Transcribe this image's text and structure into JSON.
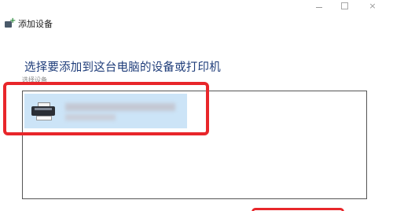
{
  "window": {
    "title": "添加设备",
    "controls": {
      "minimize": "minimize",
      "maximize": "maximize",
      "close": "×"
    }
  },
  "main": {
    "heading": "选择要添加到这台电脑的设备或打印机",
    "subheading": "选择设备"
  },
  "devices": [
    {
      "name": "",
      "detail": "",
      "icon": "printer-icon",
      "selected": true
    }
  ],
  "colors": {
    "heading": "#1f3d7a",
    "selection": "#cce4f7",
    "annotation": "#e8262a"
  }
}
